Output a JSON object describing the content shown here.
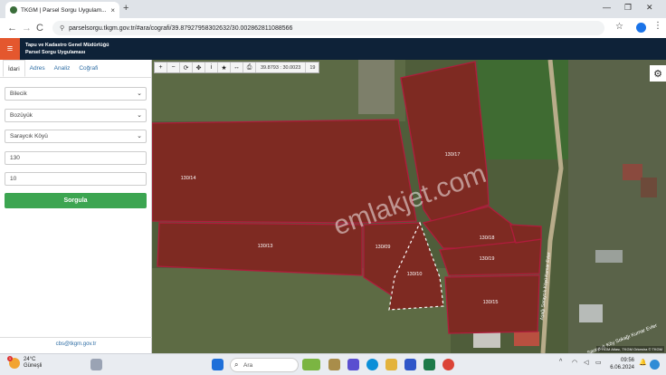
{
  "browser": {
    "tab_title": "TKGM | Parsel Sorgu Uygulam...",
    "tab_close": "×",
    "new_tab": "+",
    "url": "parselsorgu.tkgm.gov.tr/#ara/cografi/39.87927958302632/30.002862811088566",
    "win_min": "—",
    "win_max": "❐",
    "win_close": "✕",
    "back": "←",
    "forward": "→",
    "reload": "C",
    "star": "☆",
    "menu": "⋮"
  },
  "app": {
    "title_line1": "Tapu ve Kadastro Genel Müdürlüğü",
    "title_line2": "Parsel Sorgu Uygulaması",
    "menu": "≡"
  },
  "panel": {
    "tabs": [
      {
        "label": "İdari",
        "active": true
      },
      {
        "label": "Adres",
        "active": false
      },
      {
        "label": "Analiz",
        "active": false
      },
      {
        "label": "Coğrafi",
        "active": false
      }
    ],
    "province": "Bilecik",
    "district": "Bozüyük",
    "village": "Saraycık Köyü",
    "block": "130",
    "parcel": "10",
    "query_button": "Sorgula",
    "email": "cbs@tkgm.gov.tr"
  },
  "map": {
    "coordinates": "39.8793 : 30.0023",
    "zoom": "19",
    "toolbar_icons": [
      "+",
      "−",
      "⟳",
      "✥",
      "i",
      "★",
      "↔",
      "⎙"
    ],
    "parcels": [
      {
        "label": "130/17"
      },
      {
        "label": "130/14"
      },
      {
        "label": "130/13"
      },
      {
        "label": "130/18"
      },
      {
        "label": "130/19"
      },
      {
        "label": "130/10"
      },
      {
        "label": "130/15"
      },
      {
        "label": "130/09"
      }
    ],
    "road_label_1": "Saraycık Köy Sokağı Kumar Evler",
    "road_label_2": "Aşağı Saraycık Köyü Kumar Evler",
    "watermark": "emlakjet.com",
    "attribution": "© HGM Atlası, TKGM Orkestra © TKGM",
    "colors": {
      "parcel_fill": "#7e2a22",
      "parcel_border": "#b01c3c",
      "highlight": "#ffffff",
      "field": "#4c5b35"
    }
  },
  "taskbar": {
    "temp": "24°C",
    "weather": "Güneşli",
    "weather_badge": "1",
    "search": "Ara",
    "time": "09:56",
    "date": "6.06.2024"
  }
}
